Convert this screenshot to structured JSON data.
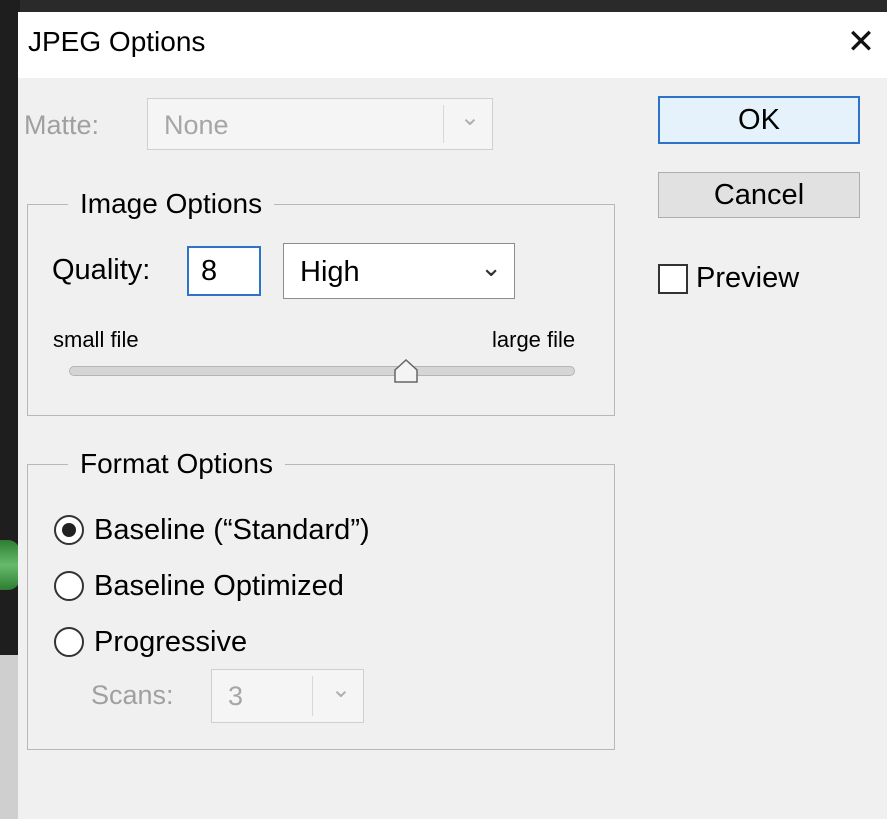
{
  "dialog": {
    "title": "JPEG Options",
    "close_glyph": "✕"
  },
  "matte": {
    "label": "Matte:",
    "value": "None",
    "enabled": false
  },
  "image_options": {
    "legend": "Image Options",
    "quality_label": "Quality:",
    "quality_value": "8",
    "quality_preset": "High",
    "slider_min_label": "small file",
    "slider_max_label": "large file",
    "slider_min": 0,
    "slider_max": 12,
    "slider_value": 8
  },
  "format_options": {
    "legend": "Format Options",
    "options": [
      {
        "label": "Baseline (“Standard”)",
        "checked": true
      },
      {
        "label": "Baseline Optimized",
        "checked": false
      },
      {
        "label": "Progressive",
        "checked": false
      }
    ],
    "scans_label": "Scans:",
    "scans_value": "3",
    "scans_enabled": false
  },
  "buttons": {
    "ok": "OK",
    "cancel": "Cancel"
  },
  "preview": {
    "label": "Preview",
    "checked": false
  },
  "icons": {
    "close": "close-icon",
    "dropdown": "chevron-down-icon",
    "slider_thumb": "slider-thumb-icon"
  },
  "colors": {
    "accent": "#2f73c9",
    "dialog_bg": "#f0f0f0",
    "disabled_text": "#a0a0a0"
  }
}
